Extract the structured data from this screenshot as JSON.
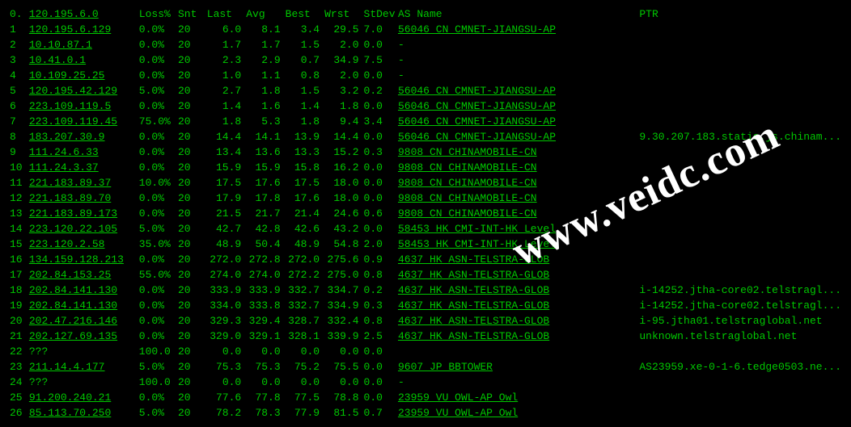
{
  "header": {
    "hop": "0.",
    "host": "120.195.6.0",
    "loss": "Loss%",
    "snt": "Snt",
    "last": "Last",
    "avg": "Avg",
    "best": "Best",
    "wrst": "Wrst",
    "stdev": "StDev",
    "asname": "AS Name",
    "ptr": "PTR"
  },
  "rows": [
    {
      "hop": "1",
      "host": "120.195.6.129",
      "loss": "0.0%",
      "snt": "20",
      "last": "6.0",
      "avg": "8.1",
      "best": "3.4",
      "wrst": "29.5",
      "stdev": "7.0",
      "as": "56046 CN CMNET-JIANGSU-AP",
      "asLink": true,
      "ptr": ""
    },
    {
      "hop": "2",
      "host": "10.10.87.1",
      "loss": "0.0%",
      "snt": "20",
      "last": "1.7",
      "avg": "1.7",
      "best": "1.5",
      "wrst": "2.0",
      "stdev": "0.0",
      "as": "-",
      "asLink": false,
      "ptr": ""
    },
    {
      "hop": "3",
      "host": "10.41.0.1",
      "loss": "0.0%",
      "snt": "20",
      "last": "2.3",
      "avg": "2.9",
      "best": "0.7",
      "wrst": "34.9",
      "stdev": "7.5",
      "as": "-",
      "asLink": false,
      "ptr": ""
    },
    {
      "hop": "4",
      "host": "10.109.25.25",
      "loss": "0.0%",
      "snt": "20",
      "last": "1.0",
      "avg": "1.1",
      "best": "0.8",
      "wrst": "2.0",
      "stdev": "0.0",
      "as": "-",
      "asLink": false,
      "ptr": ""
    },
    {
      "hop": "5",
      "host": "120.195.42.129",
      "loss": "5.0%",
      "snt": "20",
      "last": "2.7",
      "avg": "1.8",
      "best": "1.5",
      "wrst": "3.2",
      "stdev": "0.2",
      "as": "56046 CN CMNET-JIANGSU-AP",
      "asLink": true,
      "ptr": ""
    },
    {
      "hop": "6",
      "host": "223.109.119.5",
      "loss": "0.0%",
      "snt": "20",
      "last": "1.4",
      "avg": "1.6",
      "best": "1.4",
      "wrst": "1.8",
      "stdev": "0.0",
      "as": "56046 CN CMNET-JIANGSU-AP",
      "asLink": true,
      "ptr": ""
    },
    {
      "hop": "7",
      "host": "223.109.119.45",
      "loss": "75.0%",
      "snt": "20",
      "last": "1.8",
      "avg": "5.3",
      "best": "1.8",
      "wrst": "9.4",
      "stdev": "3.4",
      "as": "56046 CN CMNET-JIANGSU-AP",
      "asLink": true,
      "ptr": ""
    },
    {
      "hop": "8",
      "host": "183.207.30.9",
      "loss": "0.0%",
      "snt": "20",
      "last": "14.4",
      "avg": "14.1",
      "best": "13.9",
      "wrst": "14.4",
      "stdev": "0.0",
      "as": "56046 CN CMNET-JIANGSU-AP",
      "asLink": true,
      "ptr": "9.30.207.183.static.js.chinam..."
    },
    {
      "hop": "9",
      "host": "111.24.6.33",
      "loss": "0.0%",
      "snt": "20",
      "last": "13.4",
      "avg": "13.6",
      "best": "13.3",
      "wrst": "15.2",
      "stdev": "0.3",
      "as": "9808  CN CHINAMOBILE-CN",
      "asLink": true,
      "ptr": ""
    },
    {
      "hop": "10",
      "host": "111.24.3.37",
      "loss": "0.0%",
      "snt": "20",
      "last": "15.9",
      "avg": "15.9",
      "best": "15.8",
      "wrst": "16.2",
      "stdev": "0.0",
      "as": "9808  CN CHINAMOBILE-CN",
      "asLink": true,
      "ptr": ""
    },
    {
      "hop": "11",
      "host": "221.183.89.37",
      "loss": "10.0%",
      "snt": "20",
      "last": "17.5",
      "avg": "17.6",
      "best": "17.5",
      "wrst": "18.0",
      "stdev": "0.0",
      "as": "9808  CN CHINAMOBILE-CN",
      "asLink": true,
      "ptr": ""
    },
    {
      "hop": "12",
      "host": "221.183.89.70",
      "loss": "0.0%",
      "snt": "20",
      "last": "17.9",
      "avg": "17.8",
      "best": "17.6",
      "wrst": "18.0",
      "stdev": "0.0",
      "as": "9808  CN CHINAMOBILE-CN",
      "asLink": true,
      "ptr": ""
    },
    {
      "hop": "13",
      "host": "221.183.89.173",
      "loss": "0.0%",
      "snt": "20",
      "last": "21.5",
      "avg": "21.7",
      "best": "21.4",
      "wrst": "24.6",
      "stdev": "0.6",
      "as": "9808  CN CHINAMOBILE-CN",
      "asLink": true,
      "ptr": ""
    },
    {
      "hop": "14",
      "host": "223.120.22.105",
      "loss": "5.0%",
      "snt": "20",
      "last": "42.7",
      "avg": "42.8",
      "best": "42.6",
      "wrst": "43.2",
      "stdev": "0.0",
      "as": "58453 HK CMI-INT-HK Level",
      "asLink": true,
      "ptr": ""
    },
    {
      "hop": "15",
      "host": "223.120.2.58",
      "loss": "35.0%",
      "snt": "20",
      "last": "48.9",
      "avg": "50.4",
      "best": "48.9",
      "wrst": "54.8",
      "stdev": "2.0",
      "as": "58453 HK CMI-INT-HK Level",
      "asLink": true,
      "ptr": ""
    },
    {
      "hop": "16",
      "host": "134.159.128.213",
      "loss": "0.0%",
      "snt": "20",
      "last": "272.0",
      "avg": "272.8",
      "best": "272.0",
      "wrst": "275.6",
      "stdev": "0.9",
      "as": "4637  HK ASN-TELSTRA-GLOB",
      "asLink": true,
      "ptr": ""
    },
    {
      "hop": "17",
      "host": "202.84.153.25",
      "loss": "55.0%",
      "snt": "20",
      "last": "274.0",
      "avg": "274.0",
      "best": "272.2",
      "wrst": "275.0",
      "stdev": "0.8",
      "as": "4637  HK ASN-TELSTRA-GLOB",
      "asLink": true,
      "ptr": ""
    },
    {
      "hop": "18",
      "host": "202.84.141.130",
      "loss": "0.0%",
      "snt": "20",
      "last": "333.9",
      "avg": "333.9",
      "best": "332.7",
      "wrst": "334.7",
      "stdev": "0.2",
      "as": "4637  HK ASN-TELSTRA-GLOB",
      "asLink": true,
      "ptr": "i-14252.jtha-core02.telstragl..."
    },
    {
      "hop": "19",
      "host": "202.84.141.130",
      "loss": "0.0%",
      "snt": "20",
      "last": "334.0",
      "avg": "333.8",
      "best": "332.7",
      "wrst": "334.9",
      "stdev": "0.3",
      "as": "4637  HK ASN-TELSTRA-GLOB",
      "asLink": true,
      "ptr": "i-14252.jtha-core02.telstragl..."
    },
    {
      "hop": "20",
      "host": "202.47.216.146",
      "loss": "0.0%",
      "snt": "20",
      "last": "329.3",
      "avg": "329.4",
      "best": "328.7",
      "wrst": "332.4",
      "stdev": "0.8",
      "as": "4637  HK ASN-TELSTRA-GLOB",
      "asLink": true,
      "ptr": "i-95.jtha01.telstraglobal.net"
    },
    {
      "hop": "21",
      "host": "202.127.69.135",
      "loss": "0.0%",
      "snt": "20",
      "last": "329.0",
      "avg": "329.1",
      "best": "328.1",
      "wrst": "339.9",
      "stdev": "2.5",
      "as": "4637  HK ASN-TELSTRA-GLOB",
      "asLink": true,
      "ptr": "unknown.telstraglobal.net"
    },
    {
      "hop": "22",
      "host": "???",
      "hostPlain": true,
      "loss": "100.0",
      "snt": "20",
      "last": "0.0",
      "avg": "0.0",
      "best": "0.0",
      "wrst": "0.0",
      "stdev": "0.0",
      "as": "",
      "asLink": false,
      "ptr": ""
    },
    {
      "hop": "23",
      "host": "211.14.4.177",
      "loss": "5.0%",
      "snt": "20",
      "last": "75.3",
      "avg": "75.3",
      "best": "75.2",
      "wrst": "75.5",
      "stdev": "0.0",
      "as": "9607  JP BBTOWER",
      "asLink": true,
      "ptr": "AS23959.xe-0-1-6.tedge0503.ne..."
    },
    {
      "hop": "24",
      "host": "???",
      "hostPlain": true,
      "loss": "100.0",
      "snt": "20",
      "last": "0.0",
      "avg": "0.0",
      "best": "0.0",
      "wrst": "0.0",
      "stdev": "0.0",
      "as": "-",
      "asLink": false,
      "ptr": ""
    },
    {
      "hop": "25",
      "host": "91.200.240.21",
      "loss": "0.0%",
      "snt": "20",
      "last": "77.6",
      "avg": "77.8",
      "best": "77.5",
      "wrst": "78.8",
      "stdev": "0.0",
      "as": "23959 VU OWL-AP Owl",
      "asLink": true,
      "ptr": ""
    },
    {
      "hop": "26",
      "host": "85.113.70.250",
      "loss": "5.0%",
      "snt": "20",
      "last": "78.2",
      "avg": "78.3",
      "best": "77.9",
      "wrst": "81.5",
      "stdev": "0.7",
      "as": "23959 VU OWL-AP Owl",
      "asLink": true,
      "ptr": ""
    }
  ],
  "watermark": "www.veidc.com"
}
